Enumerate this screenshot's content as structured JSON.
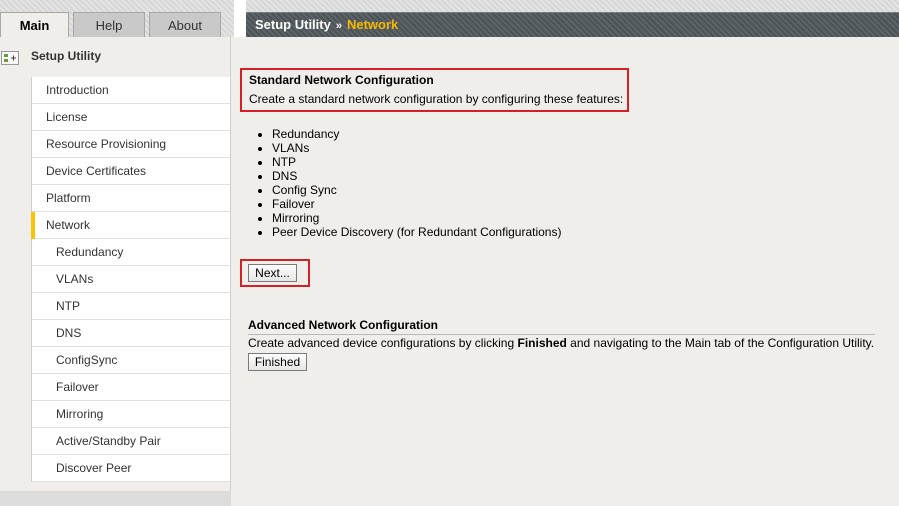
{
  "tabs": [
    {
      "label": "Main",
      "active": true
    },
    {
      "label": "Help",
      "active": false
    },
    {
      "label": "About",
      "active": false
    }
  ],
  "breadcrumb": {
    "root": "Setup Utility",
    "separator": "»",
    "current": "Network"
  },
  "sidebar": {
    "title": "Setup Utility",
    "items": [
      {
        "label": "Introduction",
        "level": 0
      },
      {
        "label": "License",
        "level": 0
      },
      {
        "label": "Resource Provisioning",
        "level": 0
      },
      {
        "label": "Device Certificates",
        "level": 0
      },
      {
        "label": "Platform",
        "level": 0
      },
      {
        "label": "Network",
        "level": 0,
        "active": true
      },
      {
        "label": "Redundancy",
        "level": 1
      },
      {
        "label": "VLANs",
        "level": 1
      },
      {
        "label": "NTP",
        "level": 1
      },
      {
        "label": "DNS",
        "level": 1
      },
      {
        "label": "ConfigSync",
        "level": 1
      },
      {
        "label": "Failover",
        "level": 1
      },
      {
        "label": "Mirroring",
        "level": 1
      },
      {
        "label": "Active/Standby Pair",
        "level": 1
      },
      {
        "label": "Discover Peer",
        "level": 1
      }
    ]
  },
  "standard": {
    "title": "Standard Network Configuration",
    "description": "Create a standard network configuration by configuring these features:",
    "features": [
      "Redundancy",
      "VLANs",
      "NTP",
      "DNS",
      "Config Sync",
      "Failover",
      "Mirroring",
      "Peer Device Discovery (for Redundant Configurations)"
    ],
    "next_label": "Next..."
  },
  "advanced": {
    "title": "Advanced Network Configuration",
    "description_pre": "Create advanced device configurations by clicking ",
    "description_bold": "Finished",
    "description_post": " and navigating to the Main tab of the Configuration Utility.",
    "finished_label": "Finished"
  },
  "colors": {
    "accent": "#f5b800",
    "highlight_border": "#d42027",
    "header_bg": "#555c60"
  }
}
